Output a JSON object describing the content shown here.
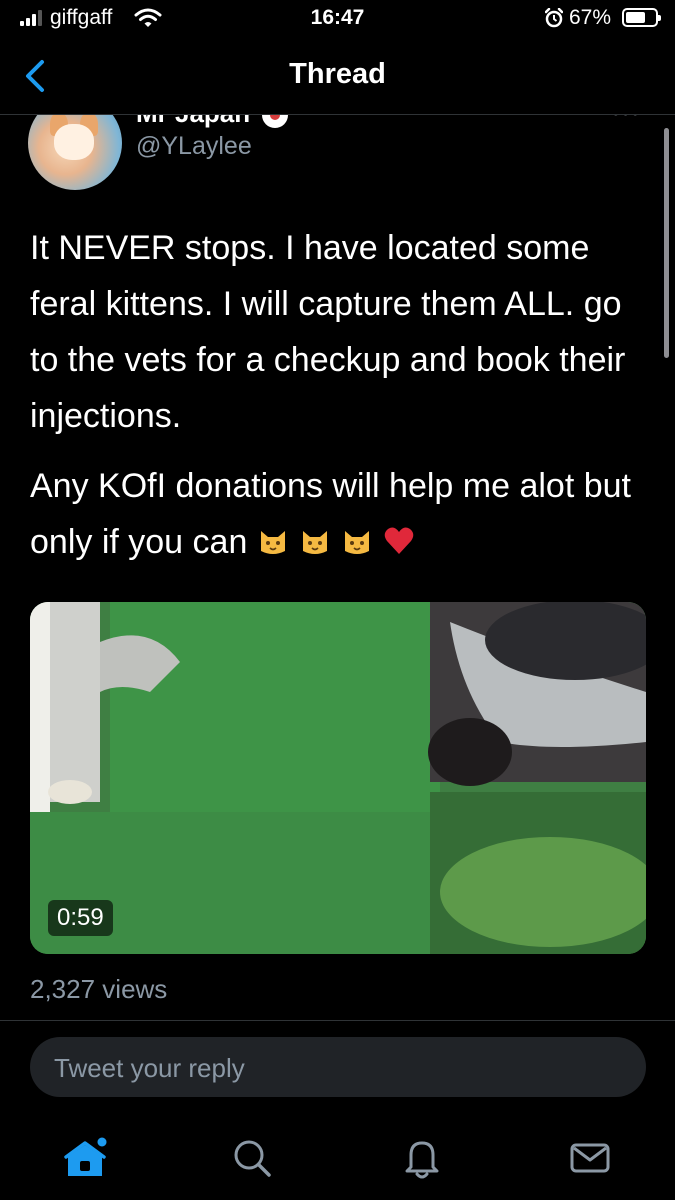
{
  "status_bar": {
    "carrier": "giffgaff",
    "time": "16:47",
    "battery_percent_label": "67%",
    "battery_level": 0.67
  },
  "nav": {
    "title": "Thread",
    "back_icon": "chevron-left-icon"
  },
  "tweet": {
    "display_name": "Mr Japan",
    "handle": "@YLaylee",
    "paragraphs": [
      "It NEVER stops. I have located some feral kittens. I will capture them ALL. go to the vets for a checkup and book their injections.",
      "Any KOfI donations will help me alot but only if you can"
    ],
    "emojis": [
      "cat-face-icon",
      "cat-face-icon",
      "cat-face-icon",
      "red-heart-icon"
    ],
    "media": {
      "duration": "0:59"
    },
    "views": "2,327 views"
  },
  "reply": {
    "placeholder": "Tweet your reply"
  },
  "tab_bar": {
    "items": [
      "home-icon",
      "search-icon",
      "notifications-icon",
      "messages-icon"
    ],
    "active": "home-icon",
    "accent_color": "#1d9bf0",
    "inactive_color": "#8b98a5"
  }
}
